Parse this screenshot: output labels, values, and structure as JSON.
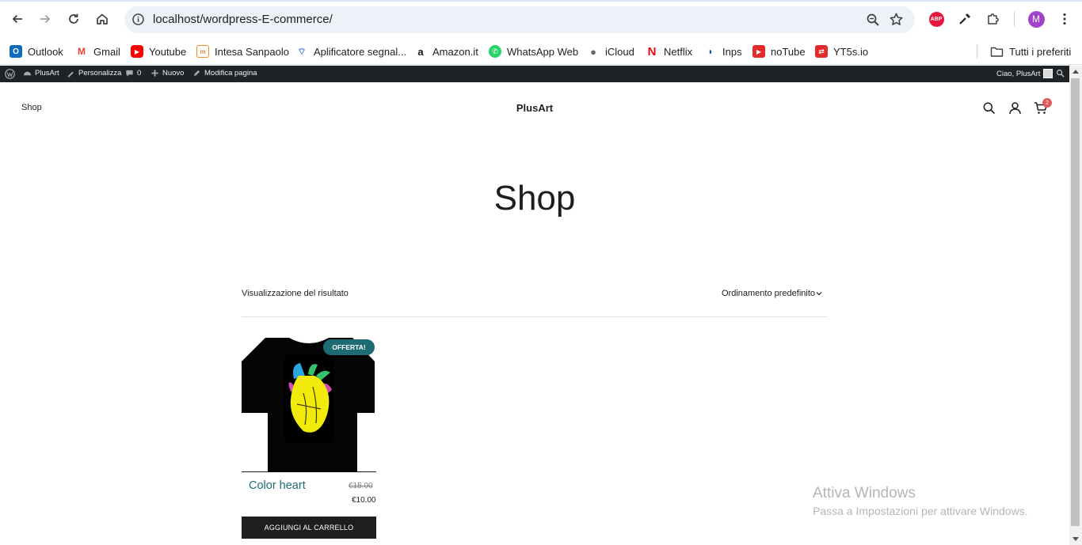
{
  "browser": {
    "url": "localhost/wordpress-E-commerce/",
    "profile_initial": "M",
    "abp_label": "ABP"
  },
  "bookmarks": [
    {
      "label": "Outlook",
      "icon": "outlook-icon",
      "color": "#0f6cbd"
    },
    {
      "label": "Gmail",
      "icon": "gmail-icon",
      "color": "#ea4335"
    },
    {
      "label": "Youtube",
      "icon": "youtube-icon",
      "color": "#ff0000"
    },
    {
      "label": "Intesa Sanpaolo",
      "icon": "intesa-icon",
      "color": "#f28c28"
    },
    {
      "label": "Aplificatore segnal...",
      "icon": "wifi-icon",
      "color": "#1a73e8"
    },
    {
      "label": "Amazon.it",
      "icon": "amazon-icon",
      "color": "#111111"
    },
    {
      "label": "WhatsApp Web",
      "icon": "whatsapp-icon",
      "color": "#25d366"
    },
    {
      "label": "iCloud",
      "icon": "apple-icon",
      "color": "#666666"
    },
    {
      "label": "Netflix",
      "icon": "netflix-icon",
      "color": "#e50914"
    },
    {
      "label": "Inps",
      "icon": "inps-icon",
      "color": "#1f4fa3"
    },
    {
      "label": "noTube",
      "icon": "notube-icon",
      "color": "#e32b2b"
    },
    {
      "label": "YT5s.io",
      "icon": "yt5s-icon",
      "color": "#e32b2b"
    }
  ],
  "bookmarks_all": "Tutti i preferiti",
  "adminbar": {
    "site": "PlusArt",
    "customize": "Personalizza",
    "comments": "0",
    "new": "Nuovo",
    "edit": "Modifica pagina",
    "greeting": "Ciao, PlusArt"
  },
  "header": {
    "nav_shop": "Shop",
    "site_title": "PlusArt",
    "cart_count": "2"
  },
  "page": {
    "title": "Shop",
    "result_count": "Visualizzazione del risultato",
    "ordering": "Ordinamento predefinito"
  },
  "products": [
    {
      "name": "Color heart",
      "badge": "OFFERTA!",
      "old_price": "€15.00",
      "price": "€10.00",
      "button": "AGGIUNGI AL CARRELLO"
    }
  ],
  "watermark": {
    "title": "Attiva Windows",
    "subtitle": "Passa a Impostazioni per attivare Windows."
  },
  "colors": {
    "accent": "#1f6b74",
    "adminbar": "#1d2327",
    "button": "#1e1e1e",
    "cart_badge": "#e35a5a"
  }
}
